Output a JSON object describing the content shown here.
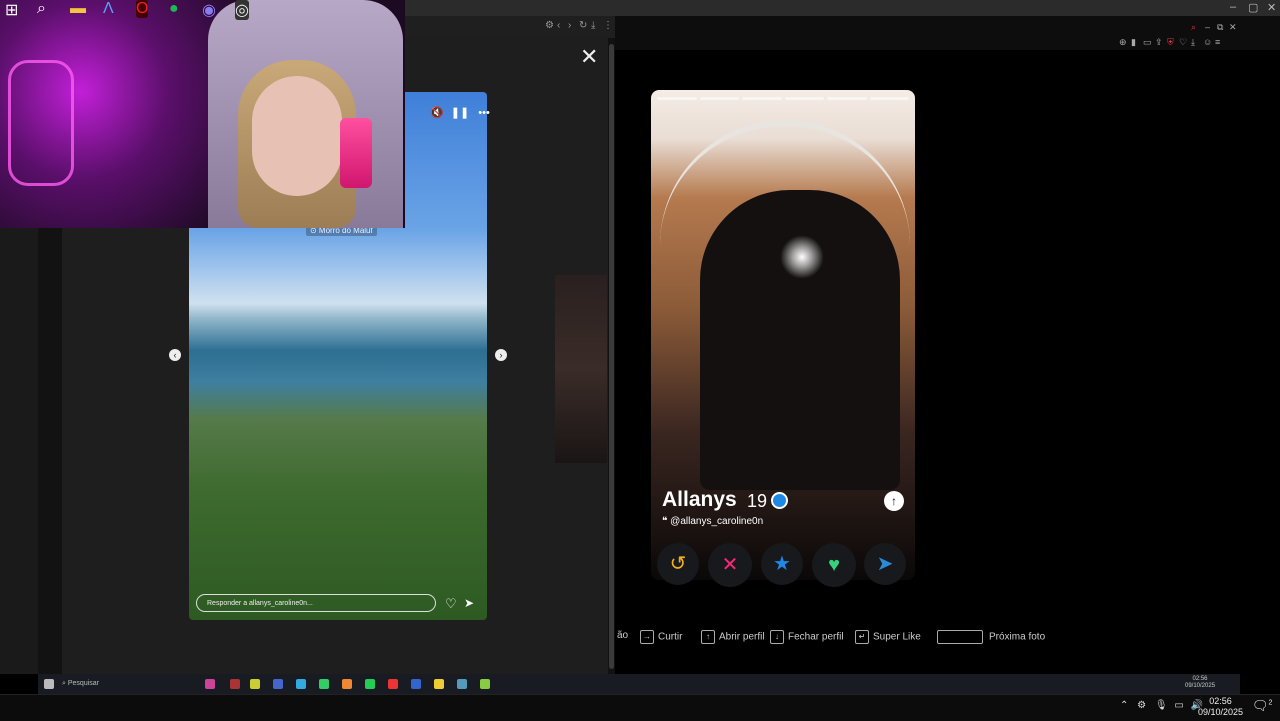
{
  "story": {
    "location": "⊙ Morro do Maluf",
    "reply_placeholder": "Responder a allanys_caroline0n..."
  },
  "profile": {
    "name": "Allanys",
    "age": "19",
    "instagram": "@allanys_caroline0n"
  },
  "shortcuts": [
    {
      "key": "",
      "label": "ão"
    },
    {
      "key": "→",
      "label": "Curtir"
    },
    {
      "key": "↑",
      "label": "Abrir perfil"
    },
    {
      "key": "↓",
      "label": "Fechar perfil"
    },
    {
      "key": "↵",
      "label": "Super Like"
    },
    {
      "key": "space",
      "label": "Próxima foto"
    }
  ],
  "inner_taskbar": {
    "search_placeholder": "Pesquisar",
    "time": "02:56",
    "date": "09/10/2025"
  },
  "taskbar": {
    "time": "02:56",
    "date": "09/10/2025",
    "notification_count": "2"
  },
  "colors": {
    "nope": "#fd267a",
    "rewind": "#f2b01e",
    "superlike": "#1e88e5",
    "like": "#37d07d",
    "boost": "#2a8cd8"
  }
}
